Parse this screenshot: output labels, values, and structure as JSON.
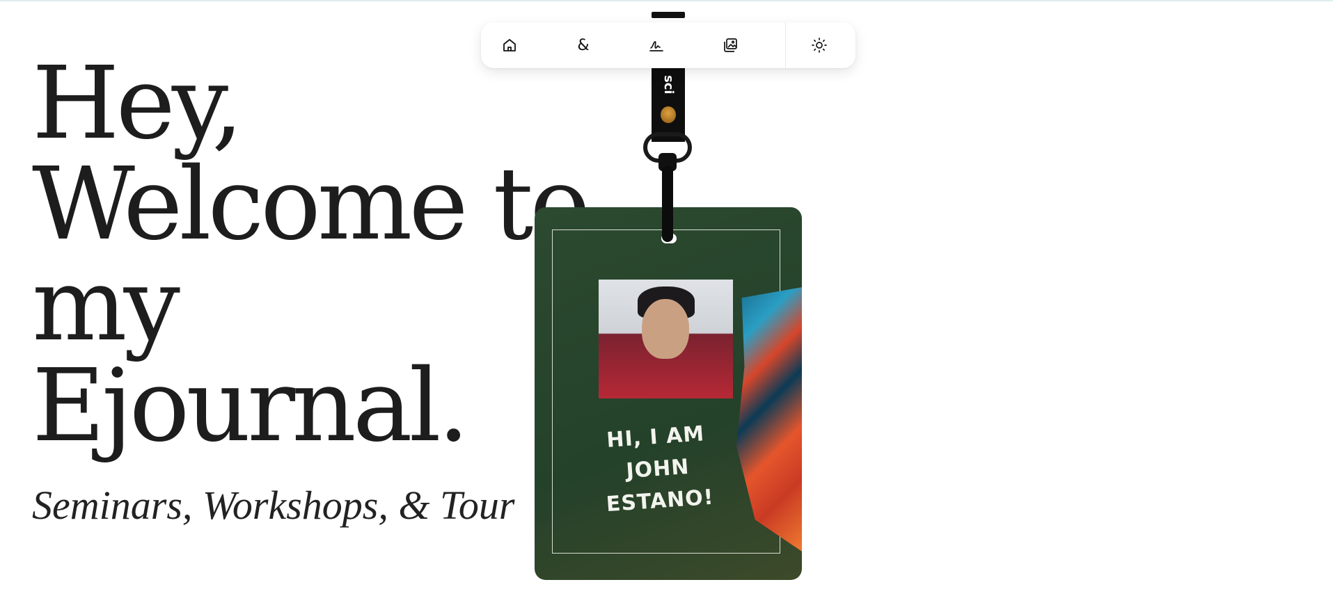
{
  "hero": {
    "line1": "Hey,",
    "line2": "Welcome to",
    "line3": "my",
    "line4": "Ejournal.",
    "subtitle": "Seminars, Workshops, & Tour"
  },
  "nav": {
    "items": [
      {
        "icon": "home-icon"
      },
      {
        "icon": "ampersand-icon",
        "glyph": "&"
      },
      {
        "icon": "signature-icon"
      },
      {
        "icon": "gallery-icon"
      },
      {
        "icon": "sun-icon"
      }
    ]
  },
  "lanyard": {
    "strap_text": "sci"
  },
  "badge": {
    "greeting_line1": "HI, I AM",
    "greeting_line2": "JOHN",
    "greeting_line3": "ESTANO!"
  }
}
